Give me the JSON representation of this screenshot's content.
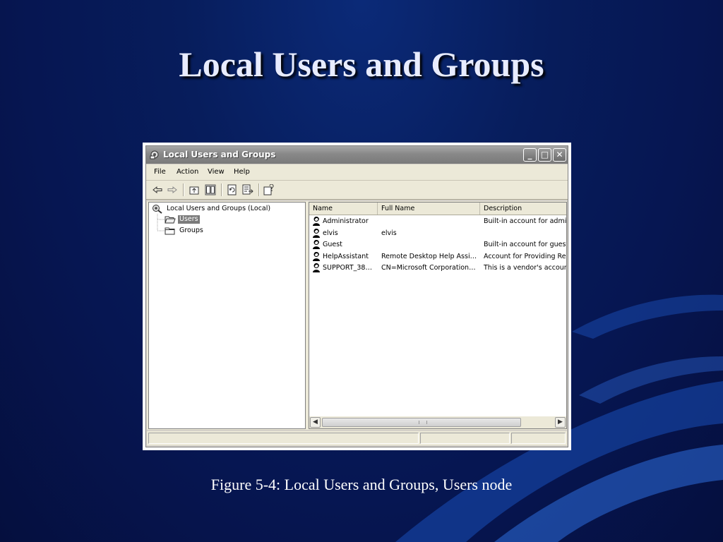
{
  "slide": {
    "title": "Local Users and Groups",
    "caption": "Figure 5-4: Local Users and Groups, Users node"
  },
  "window": {
    "title": "Local Users and Groups",
    "title_icon": "computer-management-icon",
    "controls": {
      "minimize": "_",
      "maximize": "□",
      "close": "✕"
    },
    "menu": [
      "File",
      "Action",
      "View",
      "Help"
    ],
    "toolbar": [
      "back-icon",
      "forward-icon",
      "up-one-level-icon",
      "show-hide-tree-icon",
      "refresh-icon",
      "export-list-icon",
      "help-icon"
    ]
  },
  "tree": {
    "root": "Local Users and Groups (Local)",
    "items": [
      {
        "label": "Users",
        "selected": true
      },
      {
        "label": "Groups",
        "selected": false
      }
    ]
  },
  "list": {
    "columns": [
      "Name",
      "Full Name",
      "Description"
    ],
    "rows": [
      {
        "name": "Administrator",
        "full_name": "",
        "description": "Built-in account for adminis"
      },
      {
        "name": "elvis",
        "full_name": "elvis",
        "description": ""
      },
      {
        "name": "Guest",
        "full_name": "",
        "description": "Built-in account for guest a"
      },
      {
        "name": "HelpAssistant",
        "full_name": "Remote Desktop Help Assi…",
        "description": "Account for Providing Rem"
      },
      {
        "name": "SUPPORT_38…",
        "full_name": "CN=Microsoft Corporation…",
        "description": "This is a vendor's account"
      }
    ]
  },
  "colors": {
    "background": "#061652",
    "title": "#e8ecff",
    "titlebar": "#888888",
    "selection": "#7b7b7b"
  }
}
